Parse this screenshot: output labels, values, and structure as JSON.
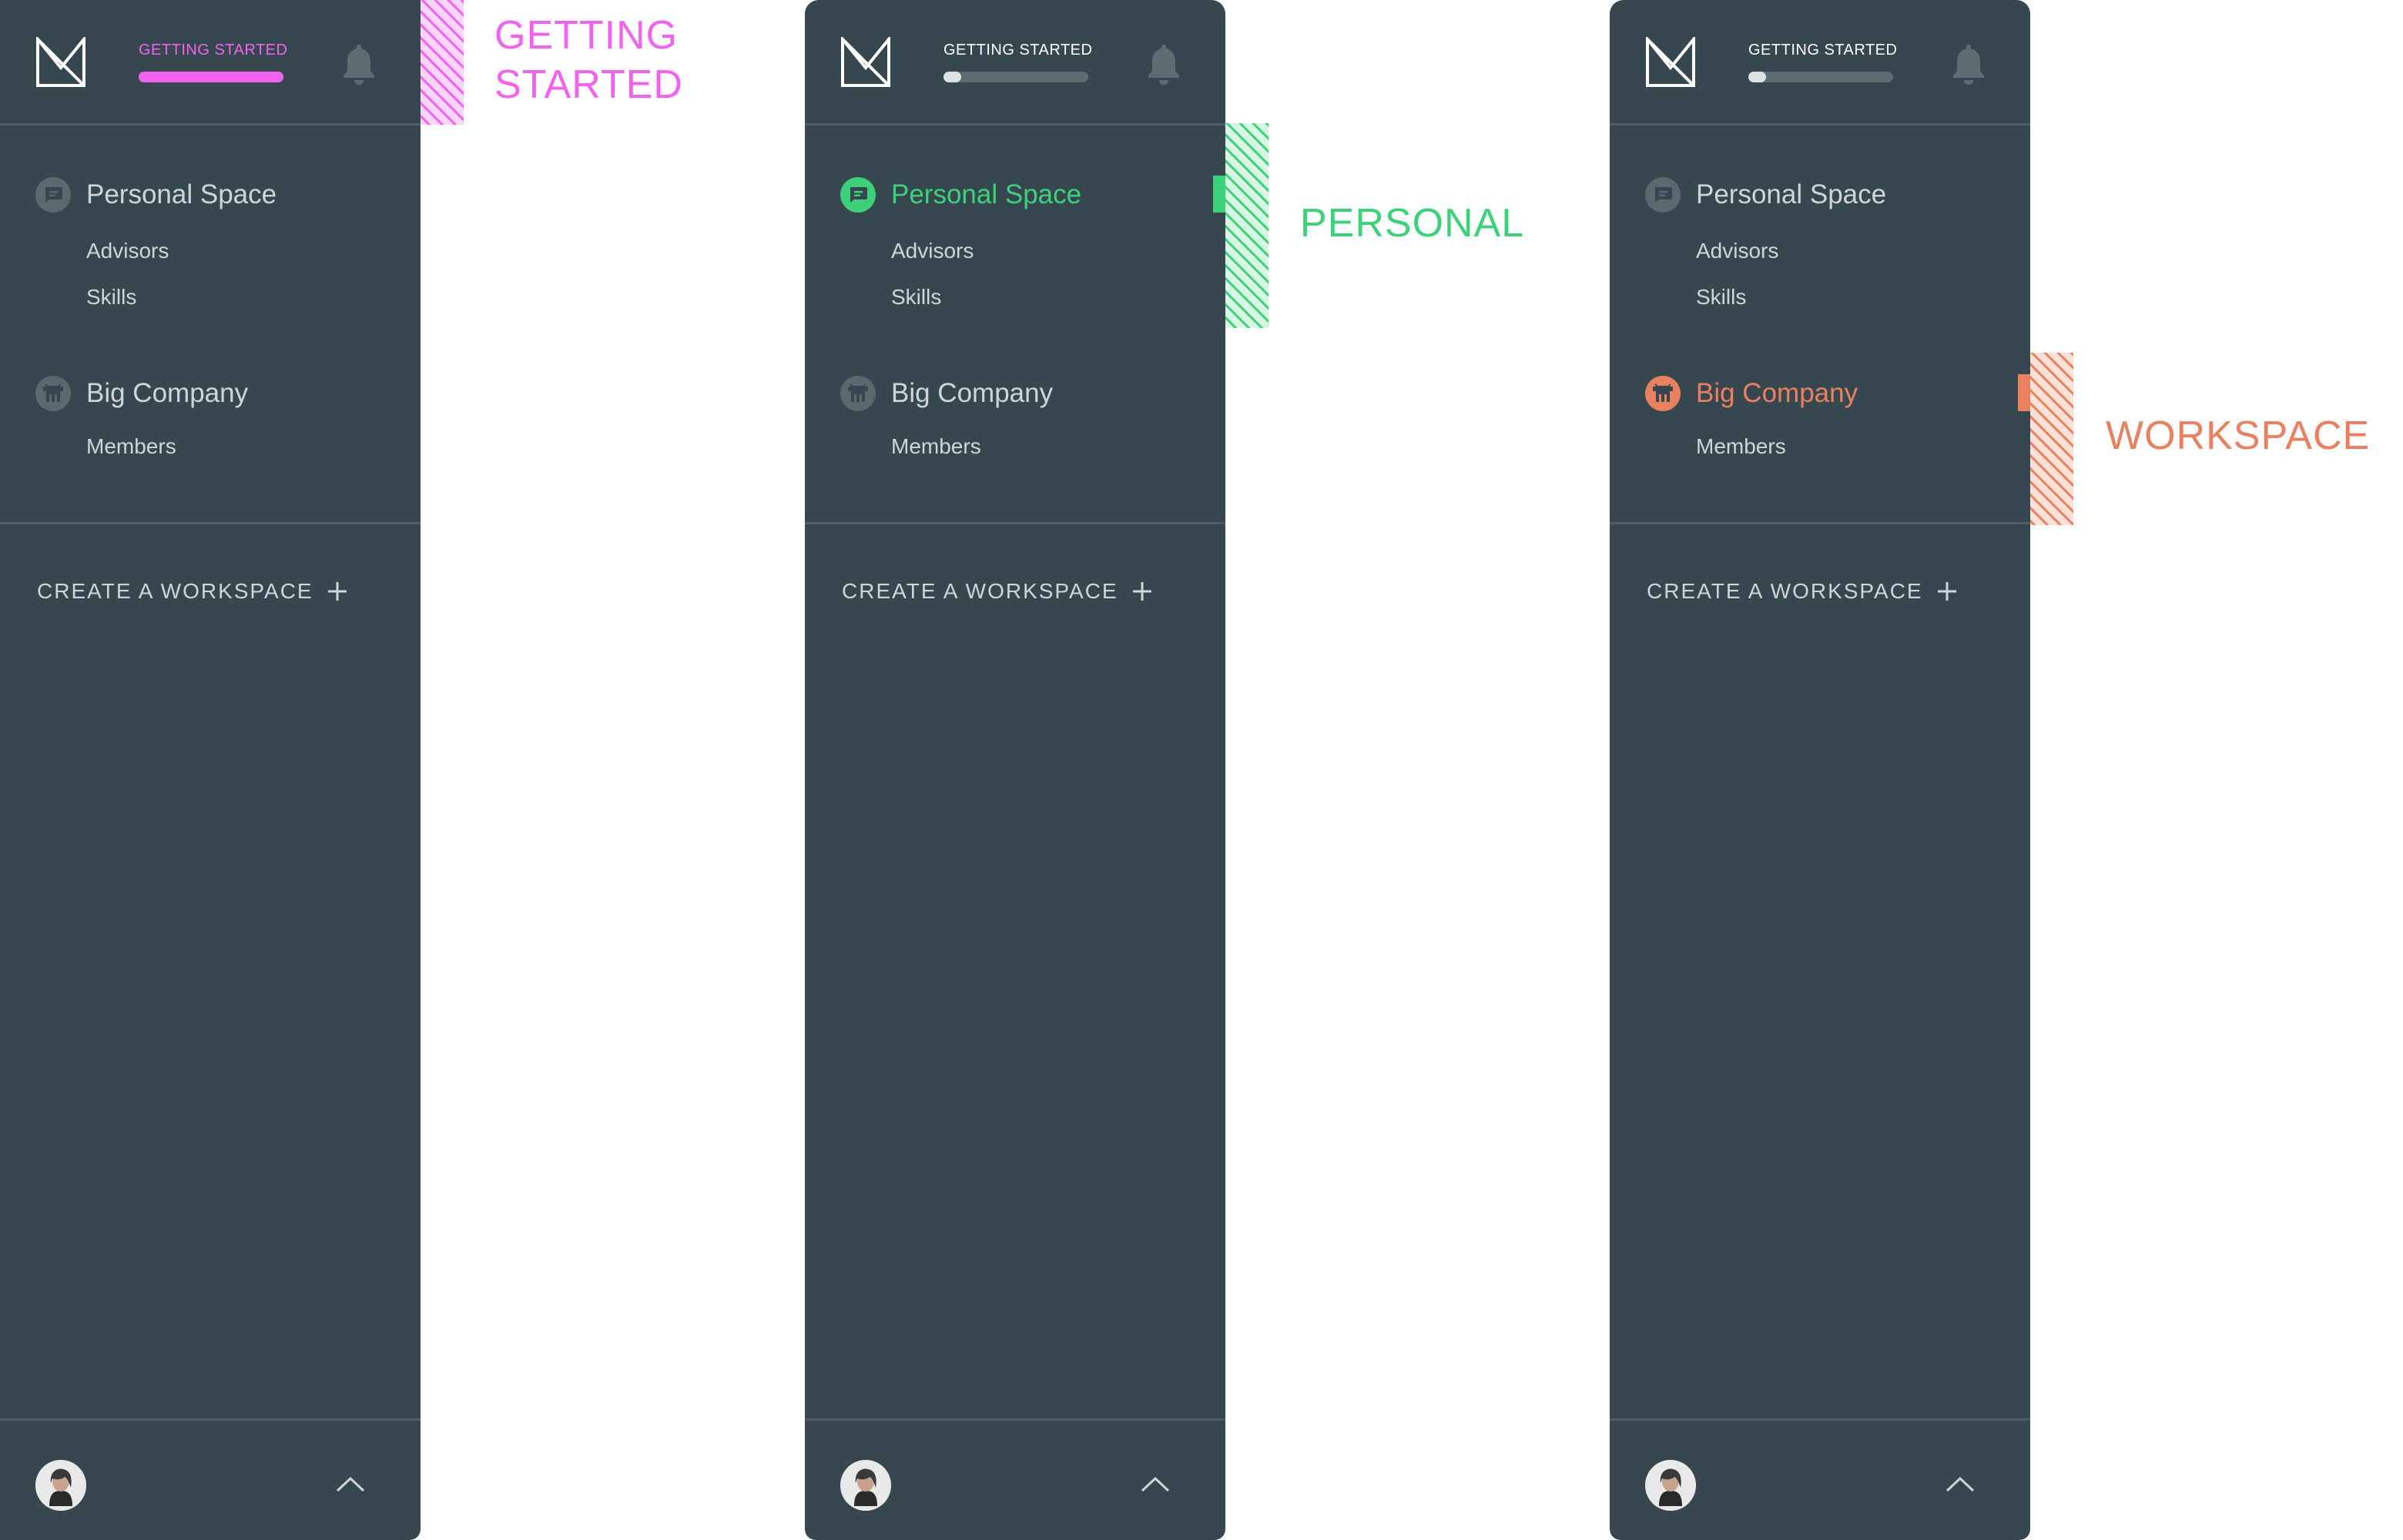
{
  "sidebar": {
    "getting_started_label": "GETTING STARTED",
    "personal": {
      "title": "Personal Space",
      "items": [
        "Advisors",
        "Skills"
      ]
    },
    "workspace": {
      "title": "Big Company",
      "items": [
        "Members"
      ]
    },
    "create_label": "CREATE A WORKSPACE"
  },
  "variants": [
    {
      "callout": [
        "GETTING",
        "STARTED"
      ],
      "accent": "#f163ee",
      "active": "getting-started",
      "progress": 1.0
    },
    {
      "callout": [
        "PERSONAL"
      ],
      "accent": "#3dd17b",
      "active": "personal-space",
      "progress": 0.12
    },
    {
      "callout": [
        "WORKSPACE"
      ],
      "accent": "#e9805f",
      "active": "workspace",
      "progress": 0.12
    }
  ],
  "colors": {
    "sidebar_bg": "#37474f",
    "divider": "#4f5e66",
    "text_muted": "#cfd5d8",
    "getting_started_accent": "#f163ee",
    "personal_accent": "#3dd17b",
    "workspace_accent": "#e9805f"
  },
  "icons": {
    "logo": "m-logo-icon",
    "bell": "bell-icon",
    "personal": "chat-icon",
    "workspace": "company-icon",
    "create": "plus-icon",
    "expand": "chevron-up-icon"
  }
}
